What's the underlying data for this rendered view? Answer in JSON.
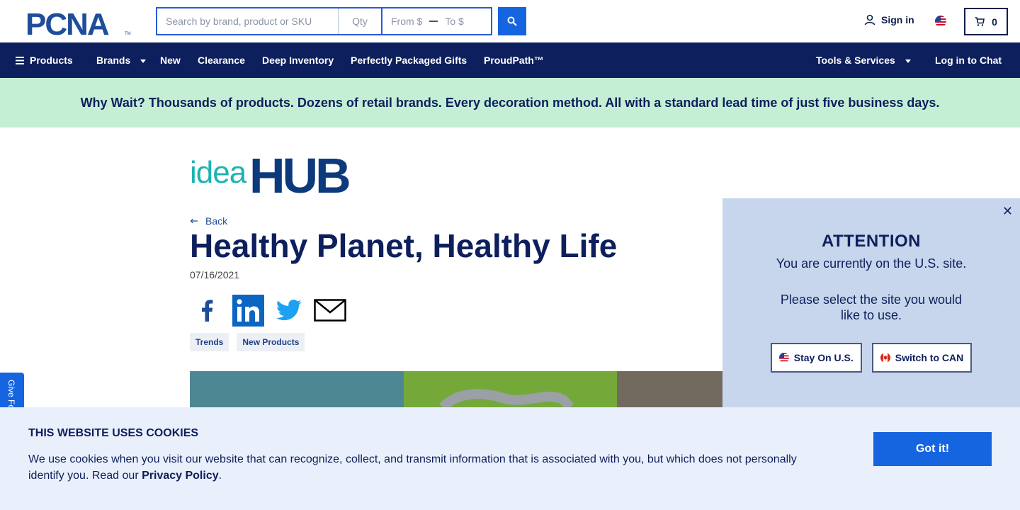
{
  "header": {
    "logo_text": "PCNA",
    "search": {
      "placeholder": "Search by brand, product or SKU",
      "qty_placeholder": "Qty",
      "from_placeholder": "From $",
      "to_placeholder": "To $"
    },
    "signin_label": "Sign in",
    "cart_count": "0"
  },
  "nav": {
    "items": [
      {
        "label": "Products"
      },
      {
        "label": "Brands"
      },
      {
        "label": "New"
      },
      {
        "label": "Clearance"
      },
      {
        "label": "Deep Inventory"
      },
      {
        "label": "Perfectly Packaged Gifts"
      },
      {
        "label": "ProudPath™"
      }
    ],
    "tools_label": "Tools & Services",
    "chat_label": "Log in to Chat"
  },
  "banner": {
    "text": "Why Wait? Thousands of products. Dozens of retail brands. Every decoration method. All with a standard lead time of just five business days."
  },
  "article": {
    "brand_idea": "idea",
    "brand_hub": "HUB",
    "back_label": "Back",
    "title": "Healthy Planet, Healthy Life",
    "date": "07/16/2021",
    "tags": [
      "Trends",
      "New Products"
    ]
  },
  "feedback_label": "Give Feedback",
  "attention": {
    "title": "ATTENTION",
    "line1": "You are currently on the U.S. site.",
    "line2": "Please select the site you would like to use.",
    "stay_label": "Stay On U.S.",
    "switch_label": "Switch to CAN"
  },
  "cookie": {
    "title": "THIS WEBSITE USES COOKIES",
    "text": "We use cookies when you visit our website that can recognize, collect, and transmit information that is associated with you, but which does not personally identify you. Read our ",
    "link": "Privacy Policy",
    "suffix": ".",
    "button": "Got it!"
  },
  "colors": {
    "brand_blue": "#1565e0",
    "navy": "#0d1f5c",
    "banner_green": "#c4efd5",
    "teal": "#1eb3b3"
  }
}
